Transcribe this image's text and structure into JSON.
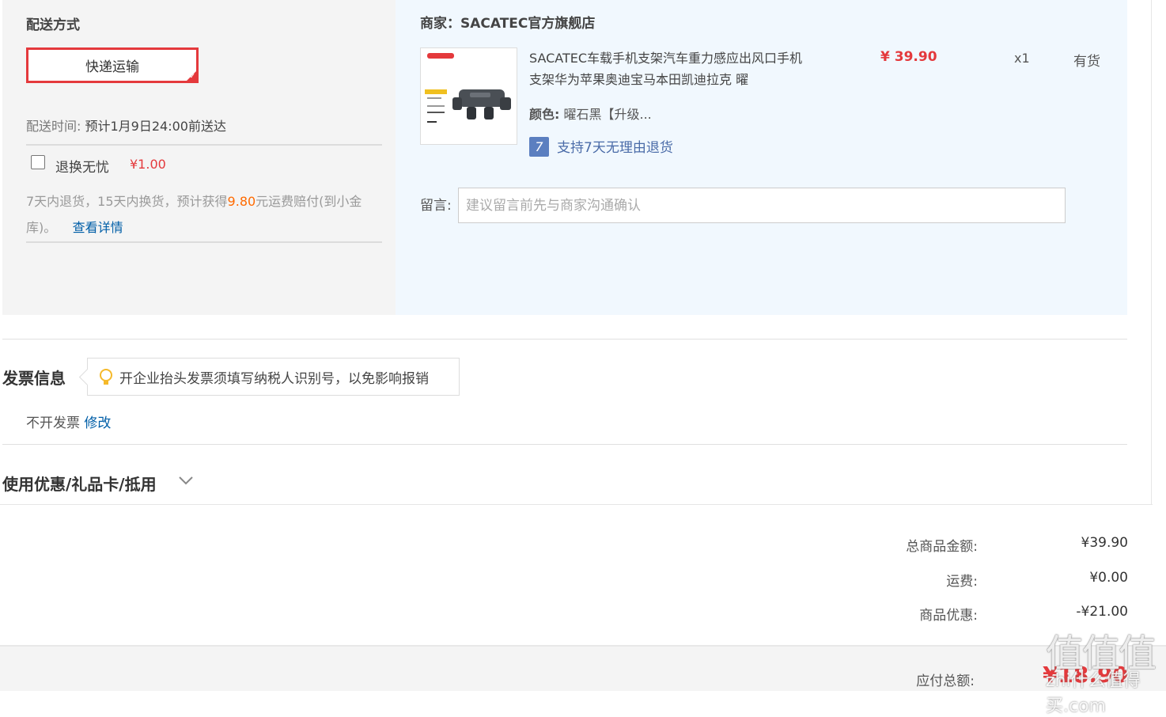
{
  "shipping": {
    "title": "配送方式",
    "method_button": "快递运输",
    "time_label": "配送时间:",
    "time_value": "预计1月9日24:00前送达",
    "worry_free_label": "退换无忧",
    "worry_free_price": "¥1.00",
    "worry_desc_part1": "7天内退货，15天内换货，预计获得",
    "worry_desc_amount": "9.80",
    "worry_desc_part2": "元运费赔付(到小金库)。",
    "details_link": "查看详情"
  },
  "seller": {
    "title": "商家：SACATEC官方旗舰店",
    "product": {
      "name": "SACATEC车载手机支架汽车重力感应出风口手机支架华为苹果奥迪宝马本田凯迪拉克 曜",
      "price": "¥ 39.90",
      "quantity": "x1",
      "stock": "有货",
      "color_label": "颜色:",
      "color_value": "曜石黑【升级...",
      "return_icon": "7",
      "return_policy": "支持7天无理由退货"
    },
    "message_label": "留言:",
    "message_placeholder": "建议留言前先与商家沟通确认"
  },
  "invoice": {
    "title": "发票信息",
    "tip": "开企业抬头发票须填写纳税人识别号，以免影响报销",
    "status": "不开发票",
    "edit_link": "修改"
  },
  "coupon": {
    "title": "使用优惠/礼品卡/抵用"
  },
  "summary": {
    "goods_label": "总商品金额:",
    "goods_value": "¥39.90",
    "freight_label": "运费:",
    "freight_value": "¥0.00",
    "discount_label": "商品优惠:",
    "discount_value": "-¥21.00",
    "total_label": "应付总额:",
    "total_value": "¥18.90"
  },
  "watermark": {
    "glyph": "值值值",
    "site": "zhi什么值得买.com"
  },
  "colors": {
    "accent_red": "#e4393c",
    "link_blue": "#005ea7",
    "orange": "#ff6a00"
  }
}
